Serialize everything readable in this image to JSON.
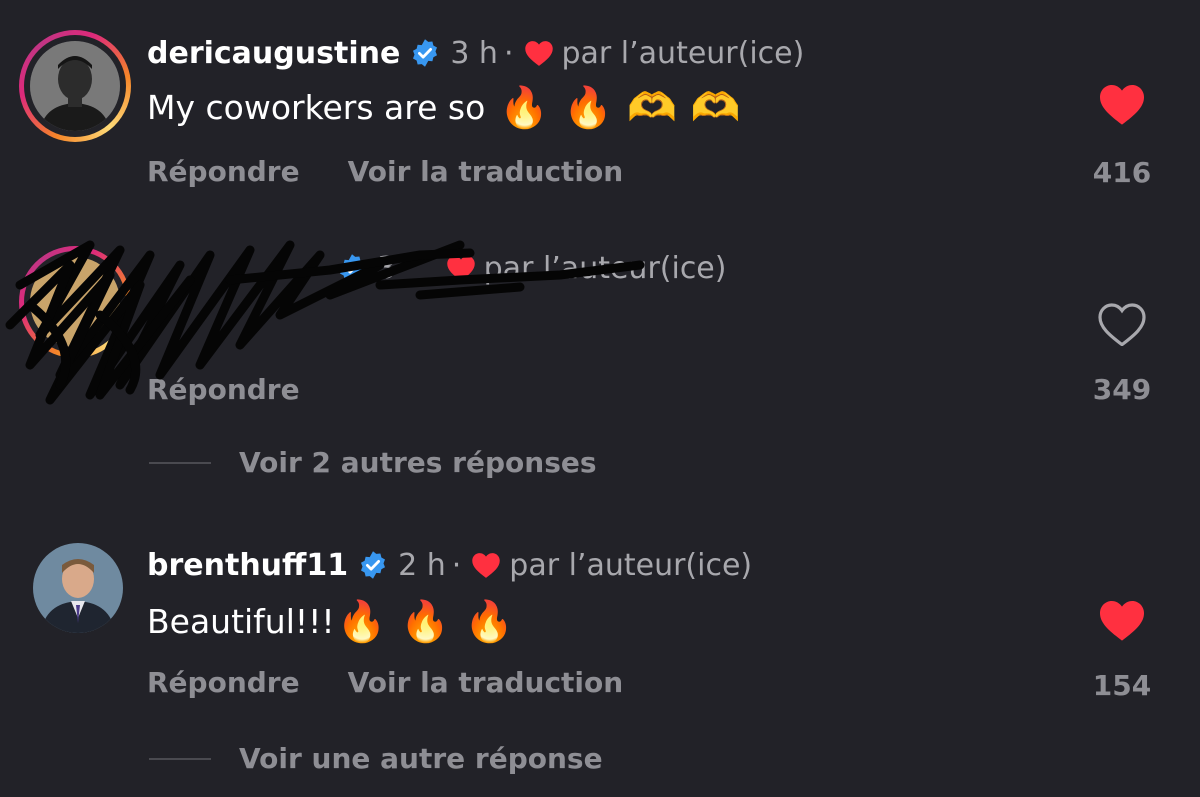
{
  "comments": [
    {
      "username": "dericaugustine",
      "time": "3 h",
      "separator": "·",
      "author_badge": "par l’auteur(ice)",
      "text": "My coworkers are so",
      "emojis": [
        "🔥",
        "🔥",
        "🫶",
        "🫶"
      ],
      "reply_label": "Répondre",
      "translate_label": "Voir la traduction",
      "likes": "416"
    },
    {
      "username": "",
      "time": "3",
      "separator": "·",
      "author_badge": "par l’auteur(ice)",
      "reply_label": "Répondre",
      "likes": "349",
      "more_replies": "Voir 2 autres réponses"
    },
    {
      "username": "brenthuff11",
      "time": "2 h",
      "separator": "·",
      "author_badge": "par l’auteur(ice)",
      "text": "Beautiful!!!",
      "emojis": [
        "🔥",
        "🔥",
        "🔥"
      ],
      "reply_label": "Répondre",
      "translate_label": "Voir la traduction",
      "likes": "154",
      "more_replies": "Voir une autre réponse"
    }
  ],
  "colors": {
    "background": "#222228",
    "muted_text": "#8e8e94",
    "like_red": "#ff3040",
    "verified_blue": "#3897f0"
  },
  "icons": [
    "verified-badge-icon",
    "heart-filled-icon",
    "heart-outline-icon",
    "fire-emoji",
    "heart-hands-emoji"
  ]
}
